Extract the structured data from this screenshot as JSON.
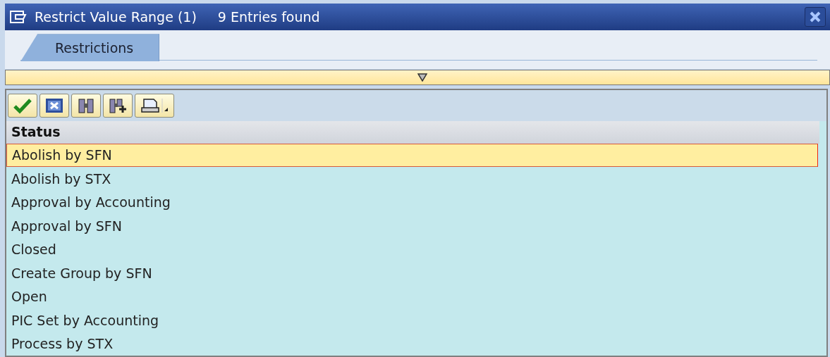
{
  "window": {
    "title": "Restrict Value Range (1)",
    "subtitle": "9 Entries found"
  },
  "tabs": [
    {
      "label": "Restrictions",
      "selected": true
    }
  ],
  "table": {
    "columns": [
      "Status"
    ],
    "rows": [
      {
        "text": "Abolish by SFN",
        "selected": true
      },
      {
        "text": "Abolish by STX",
        "selected": false
      },
      {
        "text": "Approval by Accounting",
        "selected": false
      },
      {
        "text": "Approval by SFN",
        "selected": false
      },
      {
        "text": "Closed",
        "selected": false
      },
      {
        "text": "Create Group by SFN",
        "selected": false
      },
      {
        "text": "Open",
        "selected": false
      },
      {
        "text": "PIC Set by Accounting",
        "selected": false
      },
      {
        "text": "Process by STX",
        "selected": false
      }
    ]
  }
}
